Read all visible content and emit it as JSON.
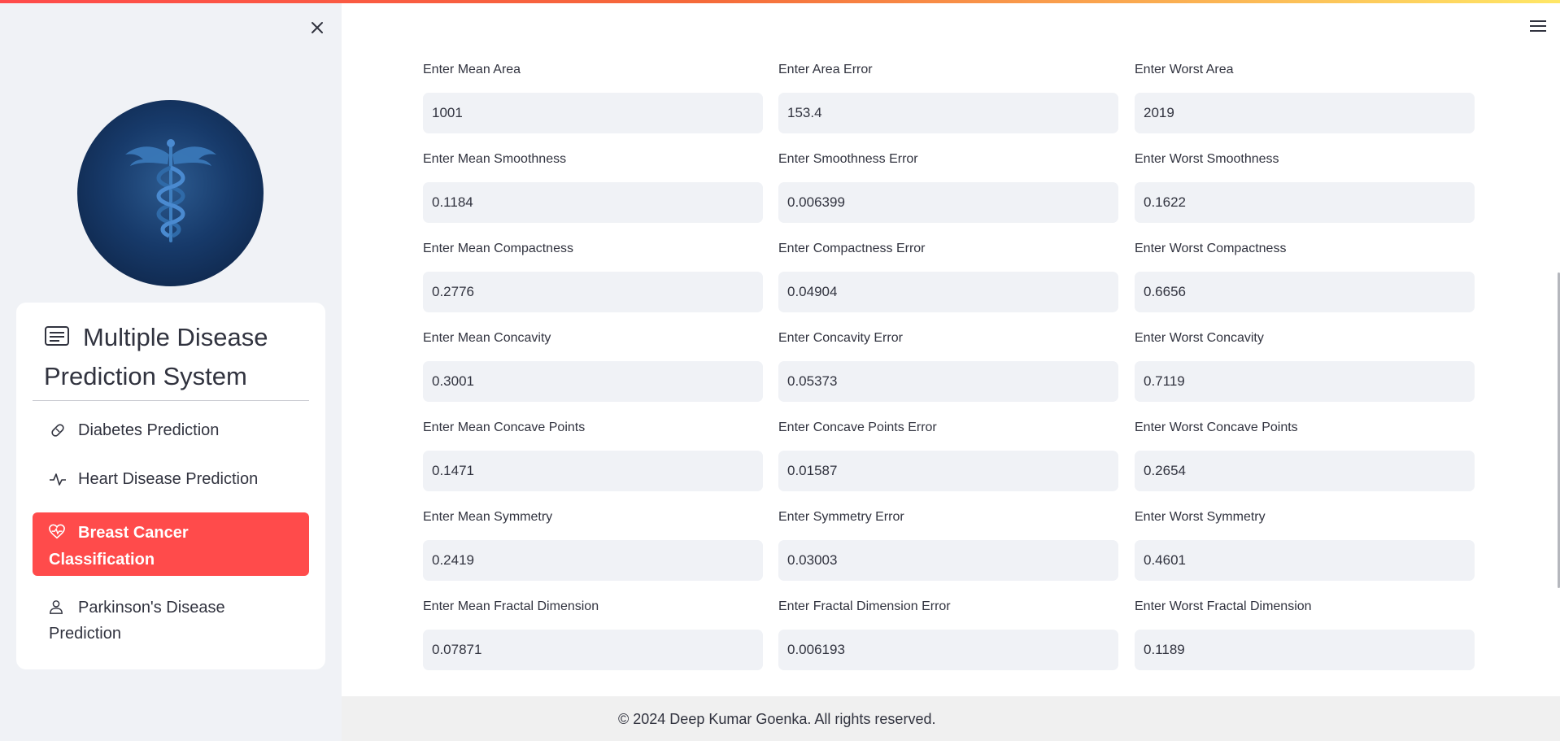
{
  "app": {
    "accent_color": "#ff4b4b"
  },
  "sidebar": {
    "close_icon": "close-icon",
    "logo_icon": "caduceus-icon",
    "menu": {
      "title": "Multiple Disease Prediction System",
      "title_icon": "article-icon",
      "items": [
        {
          "label": "Diabetes Prediction",
          "icon": "bandage-icon",
          "active": false
        },
        {
          "label": "Heart Disease Prediction",
          "icon": "activity-icon",
          "active": false
        },
        {
          "label": "Breast Cancer Classification",
          "icon": "heart-pulse-icon",
          "active": true
        },
        {
          "label": "Parkinson's Disease Prediction",
          "icon": "person-icon",
          "active": false
        }
      ]
    }
  },
  "main": {
    "menu_icon": "hamburger-icon",
    "fields": [
      [
        {
          "label": "Enter Mean Area",
          "value": "1001"
        },
        {
          "label": "Enter Area Error",
          "value": "153.4"
        },
        {
          "label": "Enter Worst Area",
          "value": "2019"
        }
      ],
      [
        {
          "label": "Enter Mean Smoothness",
          "value": "0.1184"
        },
        {
          "label": "Enter Smoothness Error",
          "value": "0.006399"
        },
        {
          "label": "Enter Worst Smoothness",
          "value": "0.1622"
        }
      ],
      [
        {
          "label": "Enter Mean Compactness",
          "value": "0.2776"
        },
        {
          "label": "Enter Compactness Error",
          "value": "0.04904"
        },
        {
          "label": "Enter Worst Compactness",
          "value": "0.6656"
        }
      ],
      [
        {
          "label": "Enter Mean Concavity",
          "value": "0.3001"
        },
        {
          "label": "Enter Concavity Error",
          "value": "0.05373"
        },
        {
          "label": "Enter Worst Concavity",
          "value": "0.7119"
        }
      ],
      [
        {
          "label": "Enter Mean Concave Points",
          "value": "0.1471"
        },
        {
          "label": "Enter Concave Points Error",
          "value": "0.01587"
        },
        {
          "label": "Enter Worst Concave Points",
          "value": "0.2654"
        }
      ],
      [
        {
          "label": "Enter Mean Symmetry",
          "value": "0.2419"
        },
        {
          "label": "Enter Symmetry Error",
          "value": "0.03003"
        },
        {
          "label": "Enter Worst Symmetry",
          "value": "0.4601"
        }
      ],
      [
        {
          "label": "Enter Mean Fractal Dimension",
          "value": "0.07871"
        },
        {
          "label": "Enter Fractal Dimension Error",
          "value": "0.006193"
        },
        {
          "label": "Enter Worst Fractal Dimension",
          "value": "0.1189"
        }
      ]
    ]
  },
  "footer": {
    "text": "© 2024 Deep Kumar Goenka. All rights reserved."
  }
}
